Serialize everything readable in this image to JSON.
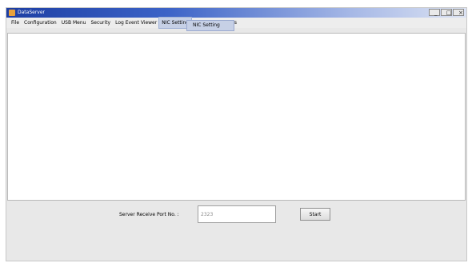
{
  "window": {
    "title": "DataServer",
    "controls": {
      "minimize": "_",
      "maximize": "□",
      "close": "×"
    }
  },
  "menu": {
    "items": [
      "File",
      "Configuration",
      "USB Menu",
      "Security",
      "Log Event Viewer",
      "NIC Setting",
      "Check PC Address"
    ],
    "active_index": 5,
    "dropdown": {
      "items": [
        "NIC Setting"
      ]
    }
  },
  "footer": {
    "port_label": "Server Receive Port No. :",
    "port_value": "2323",
    "start_label": "Start"
  },
  "colors": {
    "titlebar_start": "#1d3ea3",
    "menu_highlight": "#c6d0e6"
  }
}
